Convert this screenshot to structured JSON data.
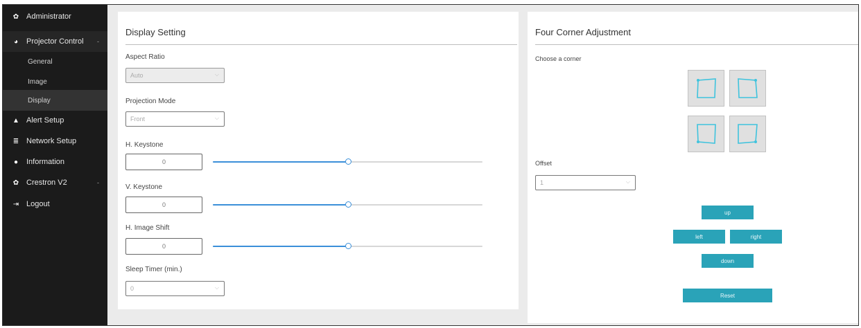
{
  "sidebar": {
    "administrator": "Administrator",
    "projector_control": "Projector Control",
    "projector_control_caret": "-",
    "general": "General",
    "image": "Image",
    "display": "Display",
    "alert_setup": "Alert Setup",
    "network_setup": "Network Setup",
    "information": "Information",
    "crestron": "Crestron V2",
    "crestron_caret": "-",
    "logout": "Logout"
  },
  "display_setting": {
    "title": "Display Setting",
    "aspect_ratio_label": "Aspect Ratio",
    "aspect_ratio_value": "Auto",
    "projection_mode_label": "Projection Mode",
    "projection_mode_value": "Front",
    "h_keystone_label": "H. Keystone",
    "h_keystone_value": "0",
    "h_keystone_level": 0.5,
    "v_keystone_label": "V. Keystone",
    "v_keystone_value": "0",
    "v_keystone_level": 0.5,
    "h_image_shift_label": "H. Image Shift",
    "h_image_shift_value": "0",
    "h_image_shift_level": 0.5,
    "sleep_timer_label": "Sleep Timer (min.)",
    "sleep_timer_value": "0"
  },
  "four_corner": {
    "title": "Four Corner Adjustment",
    "choose_label": "Choose a corner",
    "offset_label": "Offset",
    "offset_value": "1",
    "up": "up",
    "left": "left",
    "right": "right",
    "down": "down",
    "reset": "Reset"
  },
  "colors": {
    "accent": "#3a8fd9",
    "button": "#2aa3b8",
    "sidebar": "#1b1b1b",
    "corner_icon": "#3fc3dd"
  }
}
